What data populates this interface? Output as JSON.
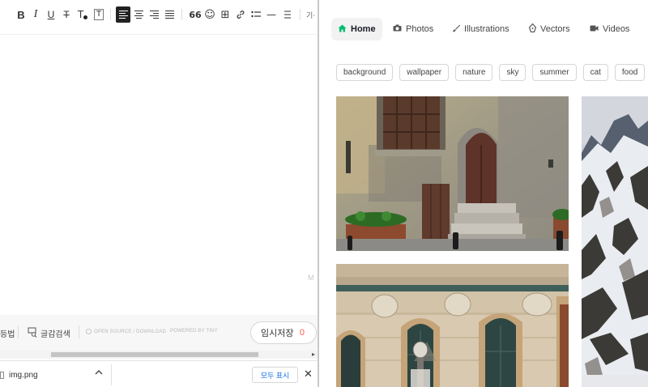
{
  "editor": {
    "toolbar": {
      "bold": "B",
      "italic": "I",
      "underline": "U",
      "strike": "T",
      "text_color": "T",
      "text_bg": "T",
      "quote": "66",
      "emoji": "☺",
      "table": "⊞",
      "link": "🔗",
      "list": "☰",
      "hr": "—",
      "more": "기·"
    },
    "corner_mark": "M",
    "bottom": {
      "left_text": "등법",
      "spell_check": "글감검색",
      "open_source": "OPEN SOURCE / DOWNLOAD",
      "powered": "POWERED BY TINY",
      "save_label": "임시저장",
      "save_count": "0"
    }
  },
  "downloads": {
    "file_name": "img.png",
    "show_all": "모두 표시"
  },
  "site": {
    "nav": [
      {
        "label": "Home",
        "icon": "home-icon",
        "active": true
      },
      {
        "label": "Photos",
        "icon": "camera-icon",
        "active": false
      },
      {
        "label": "Illustrations",
        "icon": "brush-icon",
        "active": false
      },
      {
        "label": "Vectors",
        "icon": "pen-nib-icon",
        "active": false
      },
      {
        "label": "Videos",
        "icon": "video-camera-icon",
        "active": false
      }
    ],
    "tags": [
      "background",
      "wallpaper",
      "nature",
      "sky",
      "summer",
      "cat",
      "food"
    ],
    "accent": "#02be6e"
  }
}
